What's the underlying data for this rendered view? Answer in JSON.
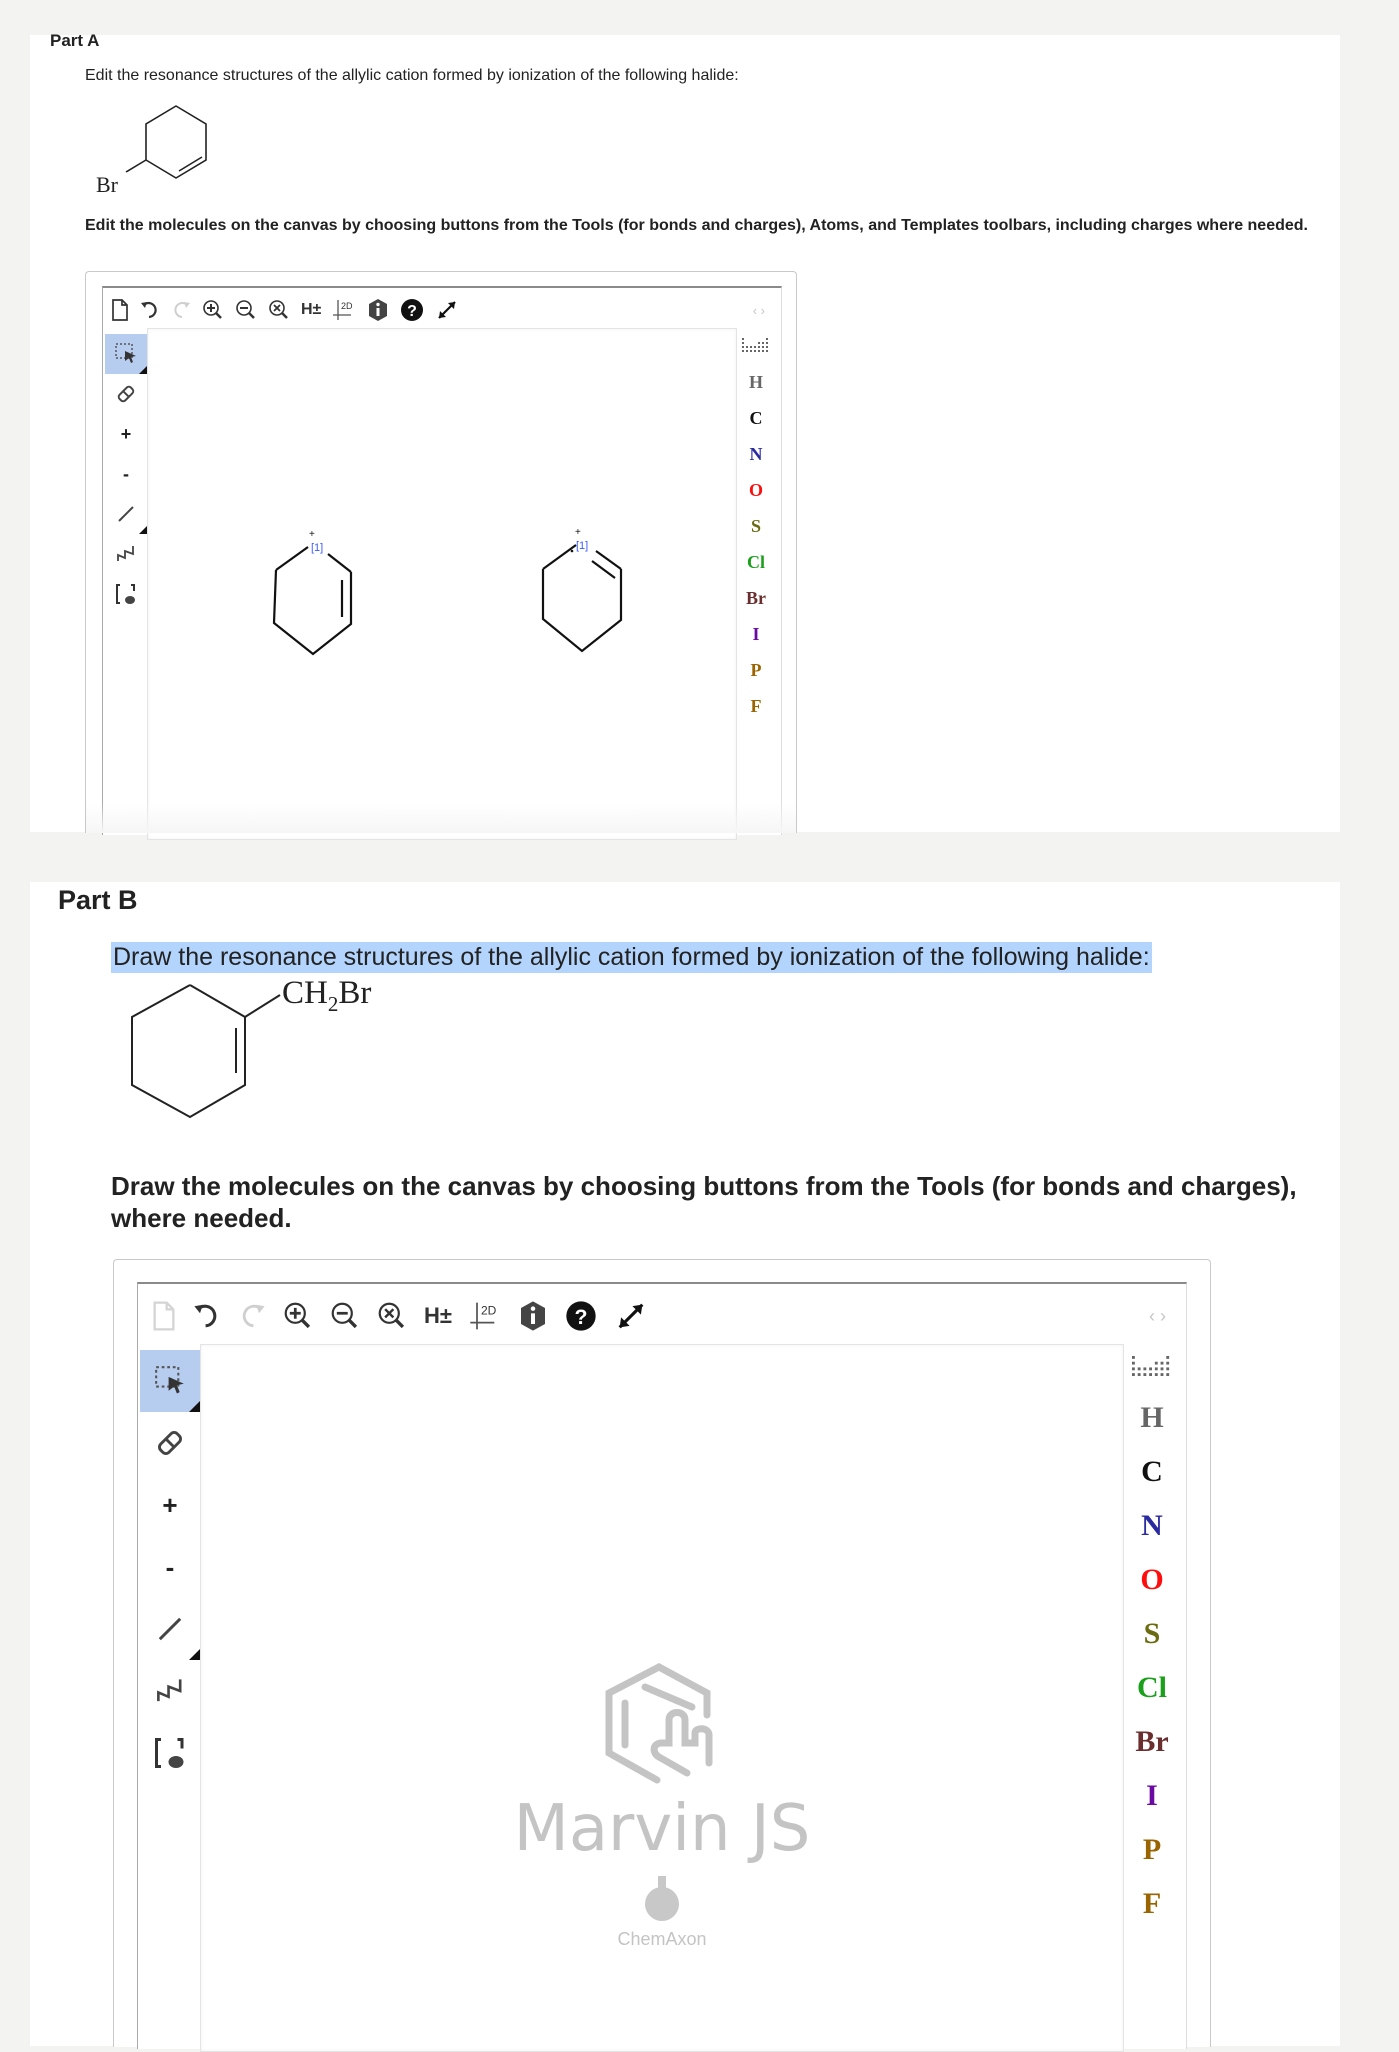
{
  "partA": {
    "label": "Part A",
    "question": "Edit the resonance structures of the allylic cation formed by ionization of the following halide:",
    "halide_substituent": "Br",
    "instructions": "Edit the molecules on the canvas by choosing buttons from the Tools (for bonds and charges), Atoms, and Templates toolbars, including charges where needed.",
    "canvas_molecules": [
      {
        "name": "resonance-structure-1",
        "charge": "+",
        "map_label": "[1]"
      },
      {
        "name": "resonance-structure-2",
        "charge": "+",
        "map_label": "[1]"
      }
    ]
  },
  "partB": {
    "label": "Part B",
    "question": "Draw the resonance structures of the allylic cation formed by ionization of the following halide:",
    "halide_substituent": {
      "main": "CH",
      "sub": "2",
      "tail": "Br"
    },
    "instructions": "Draw the molecules on the canvas by choosing buttons from the Tools (for bonds and charges), where needed.",
    "watermark": {
      "title": "Marvin JS",
      "vendor": "ChemAxon"
    }
  },
  "editor": {
    "toolbar": [
      {
        "name": "new-document-icon",
        "tooltip": "Clear"
      },
      {
        "name": "undo-icon",
        "tooltip": "Undo"
      },
      {
        "name": "redo-icon",
        "tooltip": "Redo"
      },
      {
        "name": "zoom-in-icon",
        "tooltip": "Zoom In"
      },
      {
        "name": "zoom-out-icon",
        "tooltip": "Zoom Out"
      },
      {
        "name": "zoom-reset-icon",
        "tooltip": "Zoom Reset"
      },
      {
        "name": "hydrogen-toggle-icon",
        "label": "H±"
      },
      {
        "name": "clean-2d-icon",
        "label": "2D"
      },
      {
        "name": "info-icon",
        "tooltip": "About"
      },
      {
        "name": "help-icon",
        "tooltip": "Help"
      },
      {
        "name": "fullscreen-icon",
        "tooltip": "Full Screen"
      }
    ],
    "left_tools": [
      {
        "name": "select-tool",
        "active": true
      },
      {
        "name": "eraser-tool"
      },
      {
        "name": "increase-charge-tool",
        "label": "+"
      },
      {
        "name": "decrease-charge-tool",
        "label": "-"
      },
      {
        "name": "single-bond-tool"
      },
      {
        "name": "chain-tool"
      },
      {
        "name": "bracket-tool"
      }
    ],
    "scroll_arrows": "‹ ›",
    "atoms": [
      {
        "symbol": "H",
        "color": "#666666"
      },
      {
        "symbol": "C",
        "color": "#111111"
      },
      {
        "symbol": "N",
        "color": "#2b2ba0"
      },
      {
        "symbol": "O",
        "color": "#ff0d0d"
      },
      {
        "symbol": "S",
        "color": "#6b6b10"
      },
      {
        "symbol": "Cl",
        "color": "#1aa01a"
      },
      {
        "symbol": "Br",
        "color": "#6b2e2e"
      },
      {
        "symbol": "I",
        "color": "#6a0aa0"
      },
      {
        "symbol": "P",
        "color": "#9a6400"
      },
      {
        "symbol": "F",
        "color": "#9a6400"
      }
    ]
  },
  "colors": {
    "selection_highlight": "#b3d4fc",
    "active_tool": "#b7cdf0",
    "map_label": "#3b5bff"
  }
}
